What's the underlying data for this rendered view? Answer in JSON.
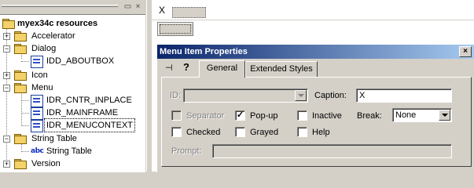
{
  "tree": {
    "root_label": "myex34c resources",
    "items": [
      {
        "label": "Accelerator"
      },
      {
        "label": "Dialog"
      },
      {
        "label": "IDD_ABOUTBOX"
      },
      {
        "label": "Icon"
      },
      {
        "label": "Menu"
      },
      {
        "label": "IDR_CNTR_INPLACE"
      },
      {
        "label": "IDR_MAINFRAME"
      },
      {
        "label": "IDR_MENUCONTEXT"
      },
      {
        "label": "String Table"
      },
      {
        "label": "String Table"
      },
      {
        "label": "Version"
      }
    ],
    "string_icon_text": "abc",
    "expand_symbol": "+",
    "collapse_symbol": "−"
  },
  "editor": {
    "menu_item_caption": "X"
  },
  "props": {
    "title": "Menu Item Properties",
    "close_glyph": "×",
    "pin_glyph": "⊣",
    "help_glyph": "?",
    "tabs": [
      "General",
      "Extended Styles"
    ],
    "id_label": "ID:",
    "id_value": "",
    "caption_label": "Caption:",
    "caption_value": "X",
    "checkboxes": {
      "separator": {
        "label": "Separator",
        "checked": false,
        "enabled": false
      },
      "popup": {
        "label": "Pop-up",
        "checked": true,
        "enabled": true
      },
      "inactive": {
        "label": "Inactive",
        "checked": false,
        "enabled": true
      },
      "checked": {
        "label": "Checked",
        "checked": false,
        "enabled": true
      },
      "grayed": {
        "label": "Grayed",
        "checked": false,
        "enabled": true
      },
      "help": {
        "label": "Help",
        "checked": false,
        "enabled": true
      }
    },
    "check_mark": "✓",
    "break_label": "Break:",
    "break_value": "None",
    "prompt_label": "Prompt:",
    "prompt_value": ""
  },
  "colors": {
    "title_start": "#0a246a",
    "title_end": "#a6caf0",
    "face": "#d4d0c8"
  }
}
